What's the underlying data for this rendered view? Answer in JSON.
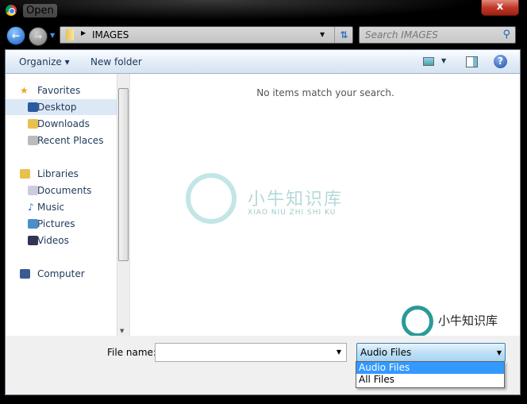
{
  "window": {
    "title": "Open",
    "close_label": "x"
  },
  "nav": {
    "back": "←",
    "forward": "→"
  },
  "address": {
    "crumb": "IMAGES"
  },
  "search": {
    "placeholder": "Search IMAGES"
  },
  "toolbar": {
    "organize": "Organize ▾",
    "new_folder": "New folder",
    "help": "?"
  },
  "sidebar": {
    "favorites": "Favorites",
    "favorite_items": [
      {
        "label": "Desktop",
        "selected": true
      },
      {
        "label": "Downloads"
      },
      {
        "label": "Recent Places"
      }
    ],
    "libraries": "Libraries",
    "library_items": [
      {
        "label": "Documents"
      },
      {
        "label": "Music"
      },
      {
        "label": "Pictures"
      },
      {
        "label": "Videos"
      }
    ],
    "computer": "Computer"
  },
  "content": {
    "empty_message": "No items match your search."
  },
  "watermark": {
    "cn": "小牛知识库",
    "latin": "XIAO NIU ZHI SHI KU"
  },
  "footer": {
    "file_name_label": "File name:",
    "file_name_value": "",
    "file_type_selected": "Audio Files",
    "file_type_options": [
      "Audio Files",
      "All Files"
    ]
  }
}
